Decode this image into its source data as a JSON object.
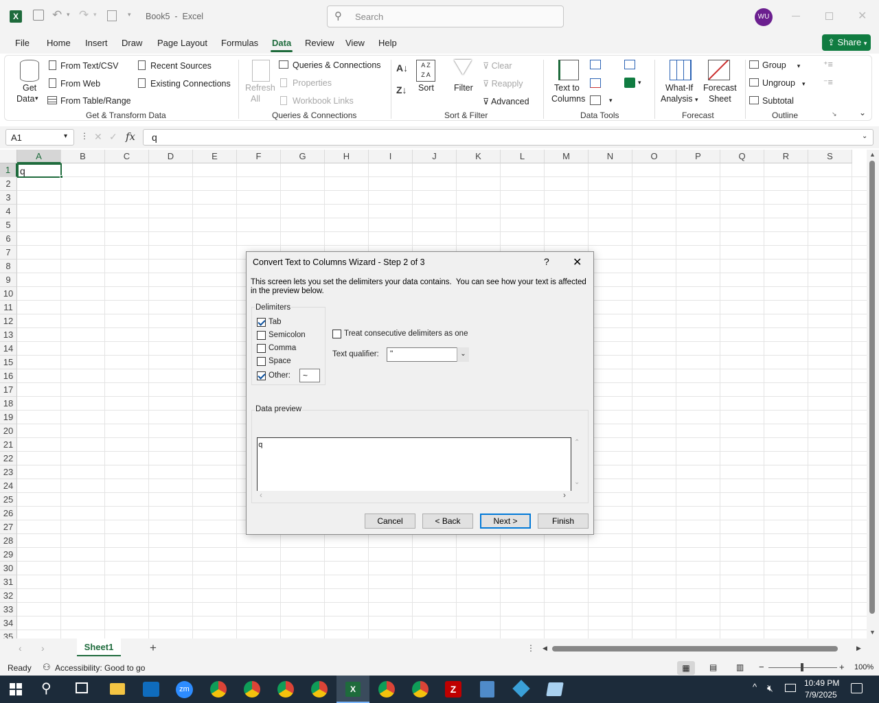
{
  "titlebar": {
    "doc_title": "Book5  -  Excel",
    "search_placeholder": "Search",
    "avatar_initials": "WU"
  },
  "tabs": [
    "File",
    "Home",
    "Insert",
    "Draw",
    "Page Layout",
    "Formulas",
    "Data",
    "Review",
    "View",
    "Help"
  ],
  "share_label": "Share",
  "ribbon": {
    "get_data": "Get",
    "get_data2": "Data",
    "from_text_csv": "From Text/CSV",
    "from_web": "From Web",
    "from_table_range": "From Table/Range",
    "recent_sources": "Recent Sources",
    "existing_connections": "Existing Connections",
    "group_get_transform": "Get & Transform Data",
    "refresh": "Refresh",
    "refresh_all": "All",
    "queries_connections": "Queries & Connections",
    "properties": "Properties",
    "workbook_links": "Workbook Links",
    "group_queries": "Queries & Connections",
    "sort": "Sort",
    "filter": "Filter",
    "clear": "Clear",
    "reapply": "Reapply",
    "advanced": "Advanced",
    "group_sort_filter": "Sort & Filter",
    "text_to_columns": "Text to",
    "text_to_columns2": "Columns",
    "group_data_tools": "Data Tools",
    "what_if": "What-If",
    "what_if2": "Analysis",
    "forecast_sheet": "Forecast",
    "forecast_sheet2": "Sheet",
    "group_forecast": "Forecast",
    "group_btn": "Group",
    "ungroup": "Ungroup",
    "subtotal": "Subtotal",
    "group_outline": "Outline"
  },
  "formula_bar": {
    "name_box": "A1",
    "fx": "fx",
    "content": "q"
  },
  "grid": {
    "columns": [
      "A",
      "B",
      "C",
      "D",
      "E",
      "F",
      "G",
      "H",
      "I",
      "J",
      "K",
      "L",
      "M",
      "N",
      "O",
      "P",
      "Q",
      "R",
      "S"
    ],
    "rows": [
      "1",
      "2",
      "3",
      "4",
      "5",
      "6",
      "7",
      "8",
      "9",
      "10",
      "11",
      "12",
      "13",
      "14",
      "15",
      "16",
      "17",
      "18",
      "19",
      "20",
      "21",
      "22",
      "23",
      "24",
      "25",
      "26",
      "27",
      "28",
      "29",
      "30",
      "31",
      "32",
      "33",
      "34",
      "35"
    ],
    "a1_value": "q"
  },
  "dialog": {
    "title": "Convert Text to Columns Wizard - Step 2 of 3",
    "help": "?",
    "description": "This screen lets you set the delimiters your data contains.  You can see how your text is affected in the preview below.",
    "delimiters_label": "Delimiters",
    "delimiters": [
      {
        "label": "Tab",
        "checked": true
      },
      {
        "label": "Semicolon",
        "checked": false
      },
      {
        "label": "Comma",
        "checked": false
      },
      {
        "label": "Space",
        "checked": false
      },
      {
        "label": "Other:",
        "checked": true
      }
    ],
    "other_value": "~",
    "consecutive_label": "Treat consecutive delimiters as one",
    "qualifier_label": "Text qualifier:",
    "qualifier_value": "\"",
    "preview_label": "Data preview",
    "preview_text": "q",
    "cancel": "Cancel",
    "back": "< Back",
    "next": "Next >",
    "finish": "Finish"
  },
  "sheets": {
    "active": "Sheet1"
  },
  "status": {
    "ready": "Ready",
    "accessibility": "Accessibility: Good to go",
    "zoom": "100%"
  },
  "taskbar": {
    "time": "10:49 PM",
    "date": "7/9/2025"
  },
  "colors": {
    "excel_green": "#1e6b3c",
    "share_green": "#107c41",
    "accent_blue": "#0078d7",
    "avatar": "#6b1f8f"
  }
}
